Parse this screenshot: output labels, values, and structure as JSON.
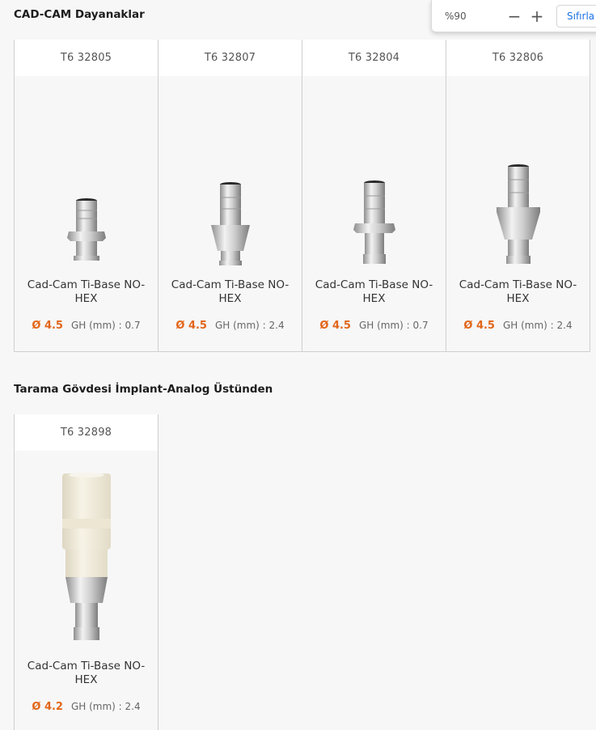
{
  "zoom": {
    "level": "%90",
    "zoom_out": "−",
    "zoom_in": "+",
    "reset_label": "Sıfırla"
  },
  "sections": [
    {
      "title": "CAD-CAM Dayanaklar",
      "products": [
        {
          "code": "T6 32805",
          "name": "Cad-Cam Ti-Base NO-HEX",
          "diameter": "Ø 4.5",
          "gh": "GH (mm) : 0.7",
          "image": "short-titanium-base-icon"
        },
        {
          "code": "T6 32807",
          "name": "Cad-Cam Ti-Base NO-HEX",
          "diameter": "Ø 4.5",
          "gh": "GH (mm) : 2.4",
          "image": "tall-titanium-base-icon"
        },
        {
          "code": "T6 32804",
          "name": "Cad-Cam Ti-Base NO-HEX",
          "diameter": "Ø 4.5",
          "gh": "GH (mm) : 0.7",
          "image": "short-titanium-base-icon"
        },
        {
          "code": "T6 32806",
          "name": "Cad-Cam Ti-Base NO-HEX",
          "diameter": "Ø 4.5",
          "gh": "GH (mm) : 2.4",
          "image": "tall-titanium-base-icon"
        }
      ]
    },
    {
      "title": "Tarama Gövdesi İmplant-Analog Üstünden",
      "products": [
        {
          "code": "T6 32898",
          "name": "Cad-Cam Ti-Base NO-HEX",
          "diameter": "Ø 4.2",
          "gh": "GH (mm) : 2.4",
          "image": "scan-body-icon"
        }
      ]
    }
  ]
}
